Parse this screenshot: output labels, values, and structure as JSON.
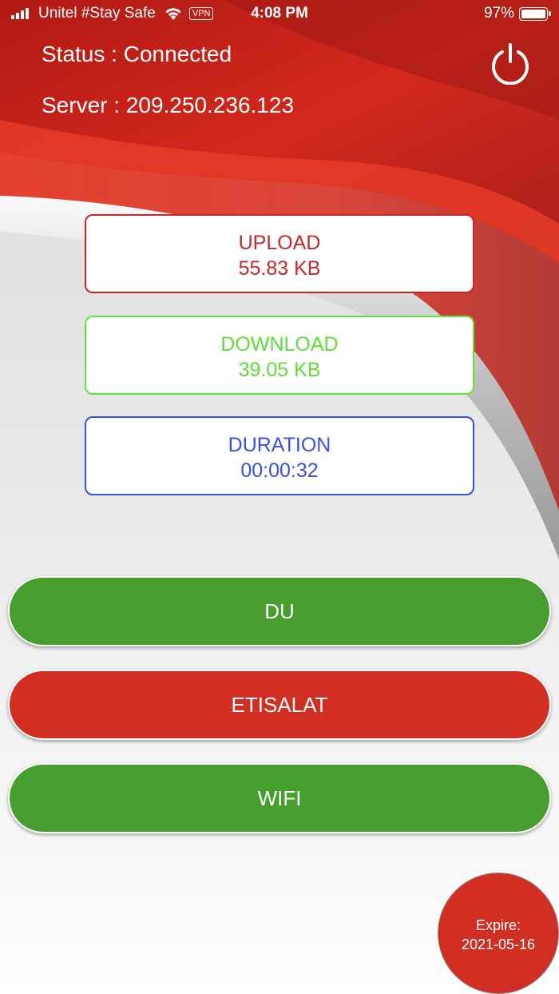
{
  "status_bar": {
    "carrier": "Unitel #Stay Safe",
    "vpn_label": "VPN",
    "time": "4:08 PM",
    "battery": "97%"
  },
  "connection": {
    "status_text": "Status : Connected",
    "server_text": "Server : 209.250.236.123"
  },
  "stats": {
    "upload": {
      "label": "UPLOAD",
      "value": "55.83 KB"
    },
    "download": {
      "label": "DOWNLOAD",
      "value": "39.05 KB"
    },
    "duration": {
      "label": "DURATION",
      "value": "00:00:32"
    }
  },
  "networks": {
    "du": "DU",
    "etisalat": "ETISALAT",
    "wifi": "WIFI"
  },
  "expire": {
    "label": "Expire:",
    "date": "2021-05-16"
  },
  "colors": {
    "header_red": "#c62828",
    "download_green": "#5fdc3a",
    "duration_blue": "#3751e3",
    "button_green": "#479e2e",
    "button_red": "#d12f23"
  },
  "icons": [
    "signal-icon",
    "wifi-icon",
    "battery-icon",
    "power-icon"
  ]
}
